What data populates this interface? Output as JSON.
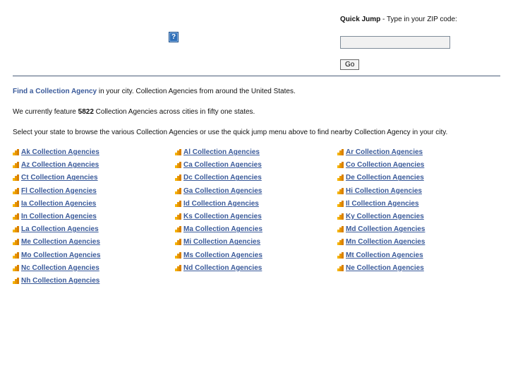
{
  "header": {
    "quick_jump_label": "Quick Jump",
    "quick_jump_text": " - Type in your ZIP code:",
    "zip_value": "",
    "go_label": "Go",
    "help_icon": "?"
  },
  "intro": {
    "link_text": "Find a Collection Agency",
    "line1_rest": " in your city. Collection Agencies from around the United States.",
    "line2_a": "We currently feature ",
    "count": "5822",
    "line2_b": " Collection Agencies across cities in fifty one states.",
    "line3": "Select your state to browse the various Collection Agencies or use the quick jump menu above to find nearby Collection Agency in your city."
  },
  "states": [
    "Ak Collection Agencies",
    "Al Collection Agencies",
    "Ar Collection Agencies",
    "Az Collection Agencies",
    "Ca Collection Agencies",
    "Co Collection Agencies",
    "Ct Collection Agencies",
    "Dc Collection Agencies",
    "De Collection Agencies",
    "Fl Collection Agencies",
    "Ga Collection Agencies",
    "Hi Collection Agencies",
    "Ia Collection Agencies",
    "Id Collection Agencies",
    "Il Collection Agencies",
    "In Collection Agencies",
    "Ks Collection Agencies",
    "Ky Collection Agencies",
    "La Collection Agencies",
    "Ma Collection Agencies",
    "Md Collection Agencies",
    "Me Collection Agencies",
    "Mi Collection Agencies",
    "Mn Collection Agencies",
    "Mo Collection Agencies",
    "Ms Collection Agencies",
    "Mt Collection Agencies",
    "Nc Collection Agencies",
    "Nd Collection Agencies",
    "Ne Collection Agencies",
    "Nh Collection Agencies"
  ],
  "colors": {
    "link": "#3a5a9a",
    "icon": "#f0a000"
  }
}
